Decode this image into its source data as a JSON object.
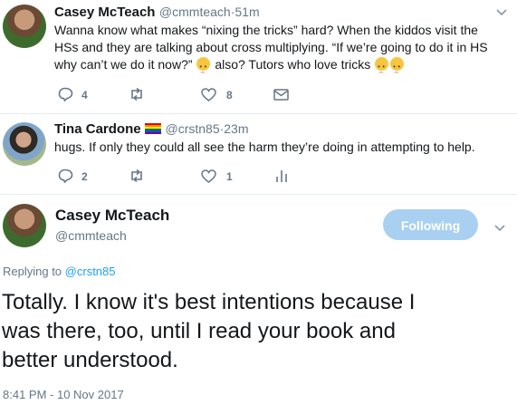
{
  "tweet1": {
    "name": "Casey McTeach",
    "handle": "@cmmteach",
    "time": "·51m",
    "line1": "Wanna know what makes “nixing the tricks” hard? When the kiddos visit the",
    "line2": "HSs and they are talking about cross multiplying. “If we’re going to do it in HS",
    "line3_a": "why can’t we do it now?”",
    "line3_b": "also? Tutors who love tricks",
    "reply_count": "4",
    "like_count": "8"
  },
  "tweet2": {
    "name": "Tina Cardone",
    "handle": "@crstn85",
    "time": "·23m",
    "text": "hugs. If only they could all see the harm they’re doing in attempting to help.",
    "reply_count": "2",
    "like_count": "1"
  },
  "main": {
    "name": "Casey McTeach",
    "handle": "@cmmteach",
    "follow_label": "Following",
    "replying_prefix": "Replying to",
    "replying_handle": "@crstn85",
    "line1": "Totally. I know it's best intentions because I",
    "line2": "was there, too, until I read your book and",
    "line3": "better understood.",
    "timestamp": "8:41 PM - 10 Nov 2017"
  },
  "icons": {
    "reply": "reply-icon",
    "retweet": "retweet-icon",
    "like": "heart-icon",
    "dm": "envelope-icon",
    "analytics": "analytics-icon",
    "caret": "chevron-down-icon"
  },
  "colors": {
    "accent": "#1da1f2",
    "follow_bg": "#a9d0f1",
    "muted": "#657786"
  }
}
